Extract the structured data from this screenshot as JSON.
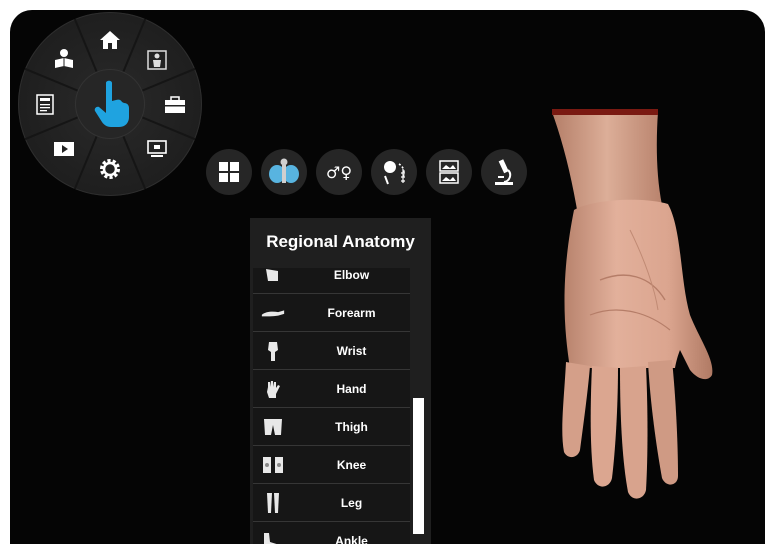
{
  "radial_menu": {
    "items": [
      {
        "name": "home-icon"
      },
      {
        "name": "anatomy-body-icon"
      },
      {
        "name": "briefcase-icon"
      },
      {
        "name": "monitor-icon"
      },
      {
        "name": "settings-gear-icon"
      },
      {
        "name": "play-video-icon"
      },
      {
        "name": "quiz-clipboard-icon"
      },
      {
        "name": "reader-person-icon"
      }
    ],
    "center": {
      "name": "touch-hand-icon",
      "color": "#1fa3e0"
    }
  },
  "toolbar": {
    "buttons": [
      {
        "name": "grid-view-icon"
      },
      {
        "name": "regional-anatomy-icon"
      },
      {
        "name": "gender-icon",
        "text": "♂♀"
      },
      {
        "name": "rotate-view-icon"
      },
      {
        "name": "image-compare-icon"
      },
      {
        "name": "microscope-icon"
      }
    ]
  },
  "panel": {
    "title": "Regional Anatomy",
    "items": [
      {
        "label": "Elbow",
        "icon": "elbow-icon"
      },
      {
        "label": "Forearm",
        "icon": "forearm-icon"
      },
      {
        "label": "Wrist",
        "icon": "wrist-icon"
      },
      {
        "label": "Hand",
        "icon": "hand-icon"
      },
      {
        "label": "Thigh",
        "icon": "thigh-icon"
      },
      {
        "label": "Knee",
        "icon": "knee-icon"
      },
      {
        "label": "Leg",
        "icon": "leg-icon"
      },
      {
        "label": "Ankle",
        "icon": "ankle-icon"
      }
    ]
  },
  "colors": {
    "accent": "#1fa3e0",
    "skin": "#d9a48d",
    "background": "#050505"
  }
}
